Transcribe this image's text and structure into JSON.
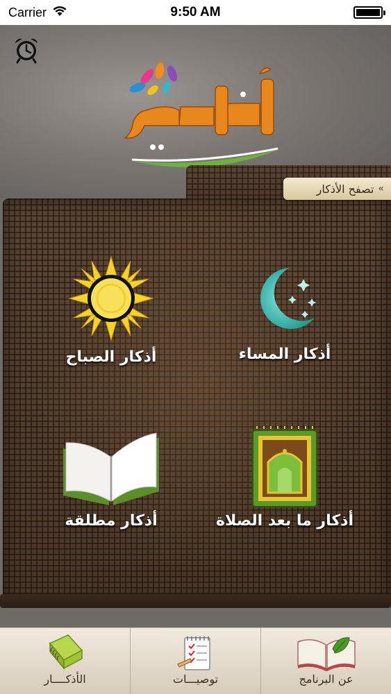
{
  "status_bar": {
    "carrier": "Carrier",
    "time": "9:50 AM",
    "battery_level": 1.0
  },
  "header": {
    "logo_text": "أذكاري",
    "alarm_icon": "alarm-clock-icon"
  },
  "folder": {
    "browse_label": "تصفح الأذكار",
    "browse_icon": "double-chevron-left-icon"
  },
  "tiles": [
    {
      "label": "أذكار المساء",
      "icon": "crescent-moon-icon"
    },
    {
      "label": "أذكار الصباح",
      "icon": "sun-icon"
    },
    {
      "label": "أذكار ما بعد الصلاة",
      "icon": "prayer-rug-icon"
    },
    {
      "label": "أذكار مطلقة",
      "icon": "open-book-icon"
    }
  ],
  "tab_bar": {
    "tabs": [
      {
        "label": "الأذكــــار",
        "icon": "notebook-icon"
      },
      {
        "label": "توصيـــات",
        "icon": "notepad-checklist-icon"
      },
      {
        "label": "عن البرنامج",
        "icon": "book-leaf-icon"
      }
    ]
  },
  "colors": {
    "folder_brown": "#4b3626",
    "label_cream": "#e8dcbc",
    "moon_teal": "#2fb8b0",
    "sun_yellow": "#f5d327",
    "logo_orange": "#e88a1c",
    "logo_green": "#6bb33b"
  }
}
